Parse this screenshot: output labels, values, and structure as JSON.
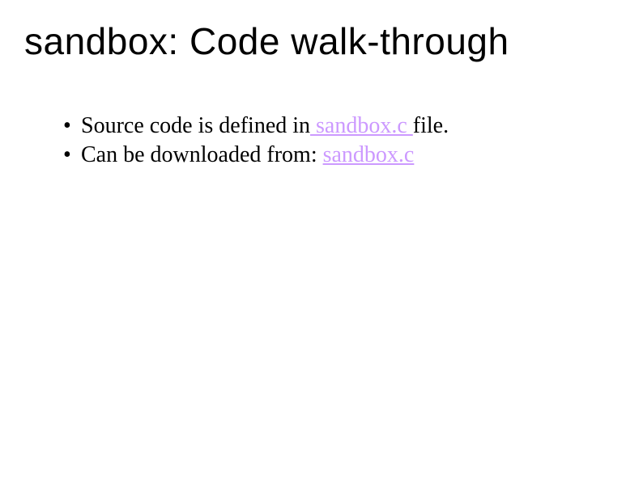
{
  "title": "sandbox: Code walk-through",
  "bullets": [
    {
      "prefix": "Source code is defined in",
      "link": " sandbox.c ",
      "suffix": "file."
    },
    {
      "prefix": "Can be downloaded from: ",
      "link": "sandbox.c",
      "suffix": ""
    }
  ]
}
